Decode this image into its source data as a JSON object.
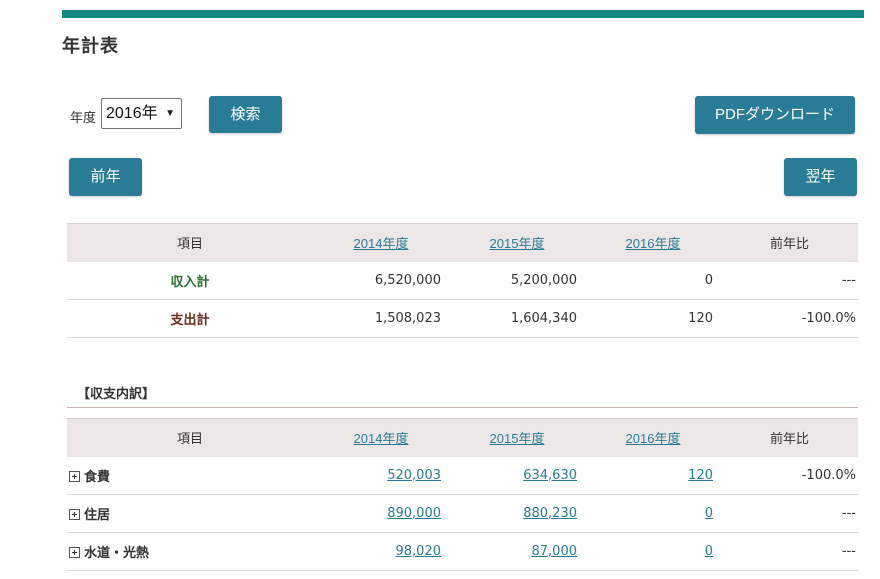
{
  "page": {
    "title": "年計表"
  },
  "controls": {
    "year_label": "年度",
    "year_selected": "2016年",
    "search_label": "検索",
    "pdf_label": "PDFダウンロード",
    "prev_label": "前年",
    "next_label": "翌年"
  },
  "columns": {
    "item": "項目",
    "y1": "2014年度",
    "y2": "2015年度",
    "y3": "2016年度",
    "ratio": "前年比"
  },
  "summary": {
    "income": {
      "label": "収入計",
      "y1": "6,520,000",
      "y2": "5,200,000",
      "y3": "0",
      "ratio": "---"
    },
    "expense": {
      "label": "支出計",
      "y1": "1,508,023",
      "y2": "1,604,340",
      "y3": "120",
      "ratio": "-100.0%"
    }
  },
  "breakdown": {
    "title": "【収支内訳】",
    "rows": [
      {
        "label": "食費",
        "y1": "520,003",
        "y2": "634,630",
        "y3": "120",
        "ratio": "-100.0%"
      },
      {
        "label": "住居",
        "y1": "890,000",
        "y2": "880,230",
        "y3": "0",
        "ratio": "---"
      },
      {
        "label": "水道・光熱",
        "y1": "98,020",
        "y2": "87,000",
        "y3": "0",
        "ratio": "---"
      }
    ]
  },
  "colors": {
    "accent_bar": "#138a85",
    "button": "#2a7c96",
    "header_bg": "#ede6e6",
    "income": "#2c6b2f",
    "expense": "#6b2a1d"
  }
}
